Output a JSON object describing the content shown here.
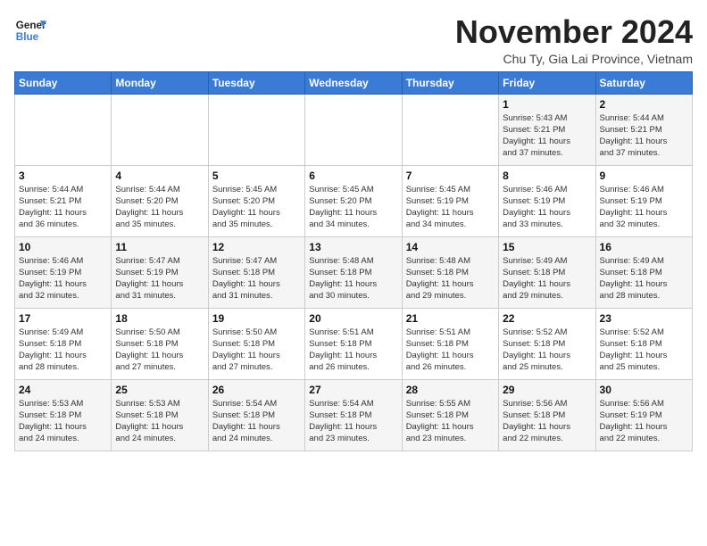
{
  "header": {
    "logo_line1": "General",
    "logo_line2": "Blue",
    "month_year": "November 2024",
    "location": "Chu Ty, Gia Lai Province, Vietnam"
  },
  "days_of_week": [
    "Sunday",
    "Monday",
    "Tuesday",
    "Wednesday",
    "Thursday",
    "Friday",
    "Saturday"
  ],
  "weeks": [
    [
      {
        "day": "",
        "info": ""
      },
      {
        "day": "",
        "info": ""
      },
      {
        "day": "",
        "info": ""
      },
      {
        "day": "",
        "info": ""
      },
      {
        "day": "",
        "info": ""
      },
      {
        "day": "1",
        "info": "Sunrise: 5:43 AM\nSunset: 5:21 PM\nDaylight: 11 hours\nand 37 minutes."
      },
      {
        "day": "2",
        "info": "Sunrise: 5:44 AM\nSunset: 5:21 PM\nDaylight: 11 hours\nand 37 minutes."
      }
    ],
    [
      {
        "day": "3",
        "info": "Sunrise: 5:44 AM\nSunset: 5:21 PM\nDaylight: 11 hours\nand 36 minutes."
      },
      {
        "day": "4",
        "info": "Sunrise: 5:44 AM\nSunset: 5:20 PM\nDaylight: 11 hours\nand 35 minutes."
      },
      {
        "day": "5",
        "info": "Sunrise: 5:45 AM\nSunset: 5:20 PM\nDaylight: 11 hours\nand 35 minutes."
      },
      {
        "day": "6",
        "info": "Sunrise: 5:45 AM\nSunset: 5:20 PM\nDaylight: 11 hours\nand 34 minutes."
      },
      {
        "day": "7",
        "info": "Sunrise: 5:45 AM\nSunset: 5:19 PM\nDaylight: 11 hours\nand 34 minutes."
      },
      {
        "day": "8",
        "info": "Sunrise: 5:46 AM\nSunset: 5:19 PM\nDaylight: 11 hours\nand 33 minutes."
      },
      {
        "day": "9",
        "info": "Sunrise: 5:46 AM\nSunset: 5:19 PM\nDaylight: 11 hours\nand 32 minutes."
      }
    ],
    [
      {
        "day": "10",
        "info": "Sunrise: 5:46 AM\nSunset: 5:19 PM\nDaylight: 11 hours\nand 32 minutes."
      },
      {
        "day": "11",
        "info": "Sunrise: 5:47 AM\nSunset: 5:19 PM\nDaylight: 11 hours\nand 31 minutes."
      },
      {
        "day": "12",
        "info": "Sunrise: 5:47 AM\nSunset: 5:18 PM\nDaylight: 11 hours\nand 31 minutes."
      },
      {
        "day": "13",
        "info": "Sunrise: 5:48 AM\nSunset: 5:18 PM\nDaylight: 11 hours\nand 30 minutes."
      },
      {
        "day": "14",
        "info": "Sunrise: 5:48 AM\nSunset: 5:18 PM\nDaylight: 11 hours\nand 29 minutes."
      },
      {
        "day": "15",
        "info": "Sunrise: 5:49 AM\nSunset: 5:18 PM\nDaylight: 11 hours\nand 29 minutes."
      },
      {
        "day": "16",
        "info": "Sunrise: 5:49 AM\nSunset: 5:18 PM\nDaylight: 11 hours\nand 28 minutes."
      }
    ],
    [
      {
        "day": "17",
        "info": "Sunrise: 5:49 AM\nSunset: 5:18 PM\nDaylight: 11 hours\nand 28 minutes."
      },
      {
        "day": "18",
        "info": "Sunrise: 5:50 AM\nSunset: 5:18 PM\nDaylight: 11 hours\nand 27 minutes."
      },
      {
        "day": "19",
        "info": "Sunrise: 5:50 AM\nSunset: 5:18 PM\nDaylight: 11 hours\nand 27 minutes."
      },
      {
        "day": "20",
        "info": "Sunrise: 5:51 AM\nSunset: 5:18 PM\nDaylight: 11 hours\nand 26 minutes."
      },
      {
        "day": "21",
        "info": "Sunrise: 5:51 AM\nSunset: 5:18 PM\nDaylight: 11 hours\nand 26 minutes."
      },
      {
        "day": "22",
        "info": "Sunrise: 5:52 AM\nSunset: 5:18 PM\nDaylight: 11 hours\nand 25 minutes."
      },
      {
        "day": "23",
        "info": "Sunrise: 5:52 AM\nSunset: 5:18 PM\nDaylight: 11 hours\nand 25 minutes."
      }
    ],
    [
      {
        "day": "24",
        "info": "Sunrise: 5:53 AM\nSunset: 5:18 PM\nDaylight: 11 hours\nand 24 minutes."
      },
      {
        "day": "25",
        "info": "Sunrise: 5:53 AM\nSunset: 5:18 PM\nDaylight: 11 hours\nand 24 minutes."
      },
      {
        "day": "26",
        "info": "Sunrise: 5:54 AM\nSunset: 5:18 PM\nDaylight: 11 hours\nand 24 minutes."
      },
      {
        "day": "27",
        "info": "Sunrise: 5:54 AM\nSunset: 5:18 PM\nDaylight: 11 hours\nand 23 minutes."
      },
      {
        "day": "28",
        "info": "Sunrise: 5:55 AM\nSunset: 5:18 PM\nDaylight: 11 hours\nand 23 minutes."
      },
      {
        "day": "29",
        "info": "Sunrise: 5:56 AM\nSunset: 5:18 PM\nDaylight: 11 hours\nand 22 minutes."
      },
      {
        "day": "30",
        "info": "Sunrise: 5:56 AM\nSunset: 5:19 PM\nDaylight: 11 hours\nand 22 minutes."
      }
    ]
  ]
}
